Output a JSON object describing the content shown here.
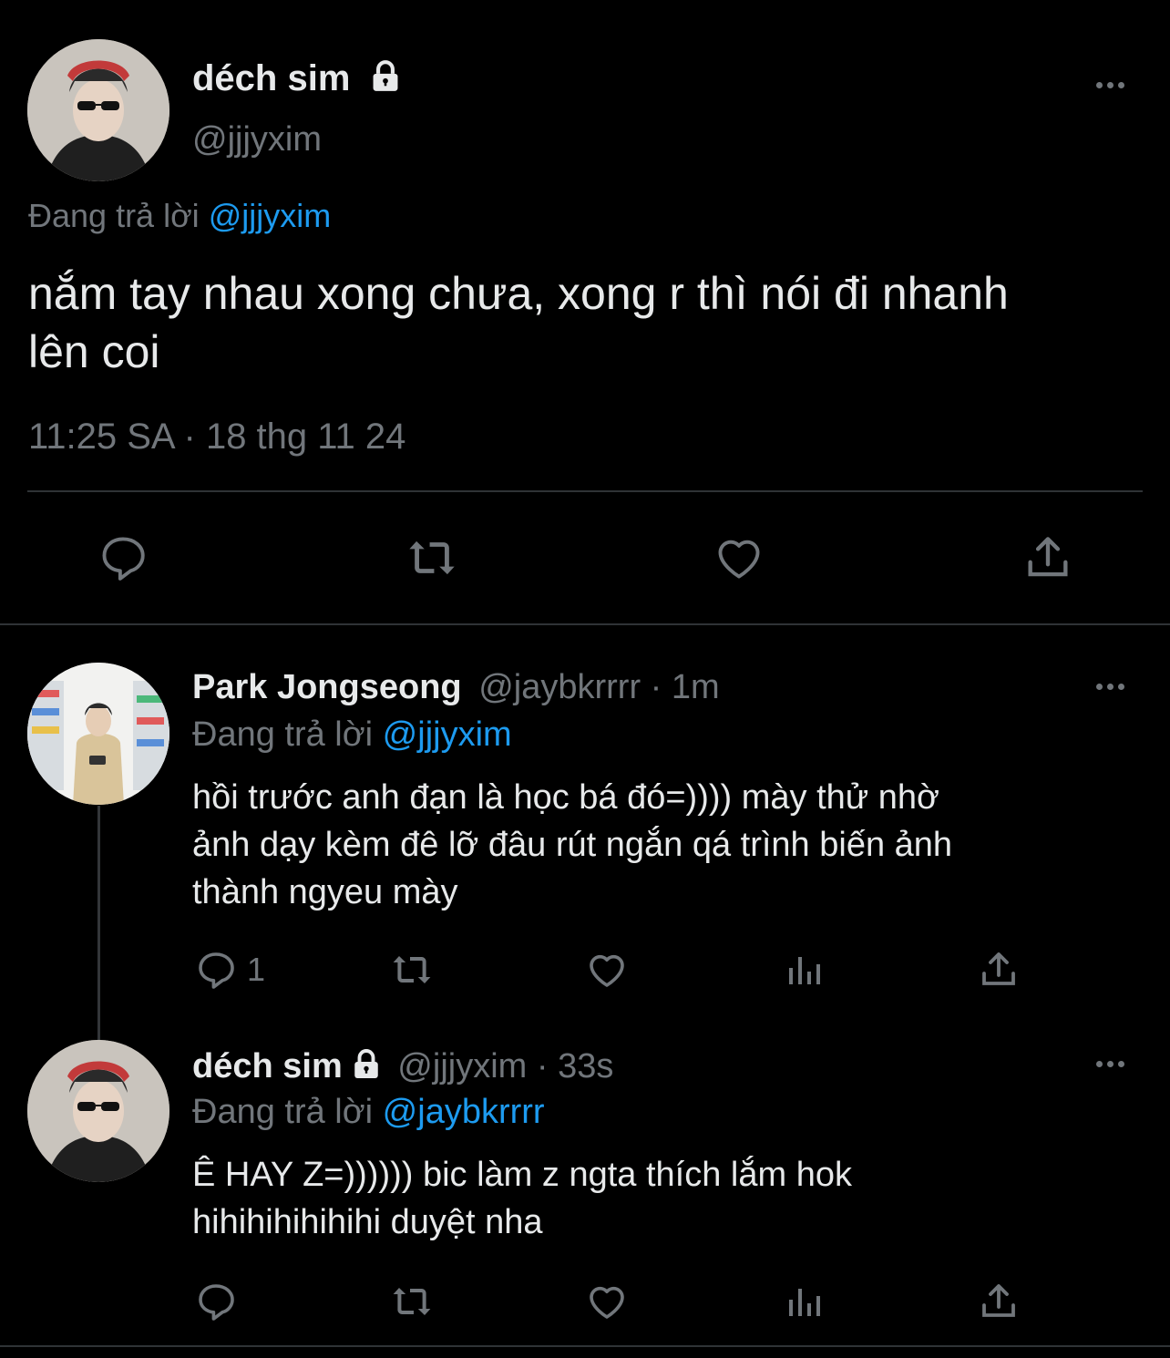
{
  "main_tweet": {
    "display_name": "déch sim",
    "handle": "@jjjyxim",
    "replying_prefix": "Đang trả lời",
    "replying_to": "@jjjyxim",
    "text_line1": "nắm tay nhau xong chưa, xong r thì nói đi nhanh",
    "text_line2": "lên coi",
    "timestamp": "11:25 SA · 18 thg 11 24"
  },
  "reply_1": {
    "display_name": "Park Jongseong",
    "handle": "@jaybkrrrr",
    "time": "· 1m",
    "replying_prefix": "Đang trả lời",
    "replying_to": "@jjjyxim",
    "text_line1": "hồi trước anh đạn là học bá đó=)))) mày thử nhờ",
    "text_line2": "ảnh dạy kèm đê lỡ đâu rút ngắn qá trình biến ảnh",
    "text_line3": "thành ngyeu mày",
    "reply_count": "1"
  },
  "reply_2": {
    "display_name": "déch sim",
    "handle": "@jjjyxim",
    "time": "· 33s",
    "replying_prefix": "Đang trả lời",
    "replying_to": "@jaybkrrrr",
    "text_line1": "Ê HAY Z=)))))) bic làm z ngta thích lắm hok",
    "text_line2": "hihihihihihihi duyệt nha"
  },
  "icons": [
    "lock-icon",
    "more-icon",
    "reply-icon",
    "retweet-icon",
    "like-icon",
    "share-icon",
    "views-icon"
  ],
  "colors": {
    "background": "#000000",
    "text": "#e7e9ea",
    "muted": "#71767b",
    "link": "#1d9bf0",
    "divider": "#2f3336"
  }
}
